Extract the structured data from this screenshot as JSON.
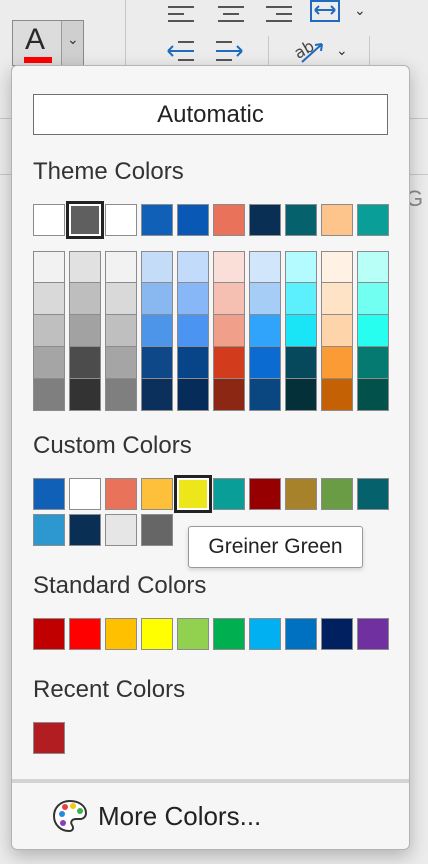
{
  "ribbon": {
    "font_color_letter": "A",
    "font_color_bar": "#ff0000",
    "partial_label": "G"
  },
  "panel": {
    "automatic_label": "Automatic",
    "theme_label": "Theme Colors",
    "custom_label": "Custom Colors",
    "standard_label": "Standard Colors",
    "recent_label": "Recent Colors",
    "more_colors_label": "More Colors...",
    "tooltip": "Greiner Green",
    "theme_top": [
      "#ffffff",
      "#5f5f5f",
      "#ffffff",
      "#1160b7",
      "#0a58b6",
      "#e8735a",
      "#092f54",
      "#05616c",
      "#fdc58c",
      "#0a9e98"
    ],
    "theme_shades": [
      [
        "#f2f2f2",
        "#d9d9d9",
        "#bfbfbf",
        "#a5a5a5",
        "#7f7f7f"
      ],
      [
        "#e1e1e1",
        "#bebebe",
        "#a2a2a2",
        "#4c4c4c",
        "#333333"
      ],
      [
        "#f2f2f2",
        "#d9d9d9",
        "#bfbfbf",
        "#a5a5a5",
        "#7f7f7f"
      ],
      [
        "#c4dcf8",
        "#89b8f0",
        "#4d95e8",
        "#0f4889",
        "#0a305b"
      ],
      [
        "#c3dbfb",
        "#87b7f6",
        "#4b94f2",
        "#084488",
        "#062d5a"
      ],
      [
        "#fadfd8",
        "#f5bfb1",
        "#f09f8a",
        "#d33b1d",
        "#8c2713"
      ],
      [
        "#d2e6fb",
        "#a5cdf6",
        "#30a3fb",
        "#0c6bd0",
        "#0a4680"
      ],
      [
        "#b3fbff",
        "#5cf0ff",
        "#1ae5f6",
        "#06495c",
        "#043039"
      ],
      [
        "#fff1e3",
        "#ffe3c7",
        "#fed5ab",
        "#fa9b36",
        "#c46105"
      ],
      [
        "#b7fff7",
        "#70fff0",
        "#27fef0",
        "#057a70",
        "#03514b"
      ]
    ],
    "custom_row1": [
      "#1160b7",
      "#ffffff",
      "#e8735a",
      "#fec03a",
      "#ece61a",
      "#0a9e98",
      "#960000",
      "#a8822a",
      "#6a9c45",
      "#05616c"
    ],
    "custom_row2": [
      "#2c98cf",
      "#092f54",
      "#e6e6e6",
      "#666666"
    ],
    "standard": [
      "#c00000",
      "#ff0000",
      "#ffc000",
      "#ffff00",
      "#92d050",
      "#00b050",
      "#00b0f0",
      "#0070c0",
      "#002060",
      "#7030a0"
    ],
    "recent": [
      "#b21d22"
    ]
  }
}
